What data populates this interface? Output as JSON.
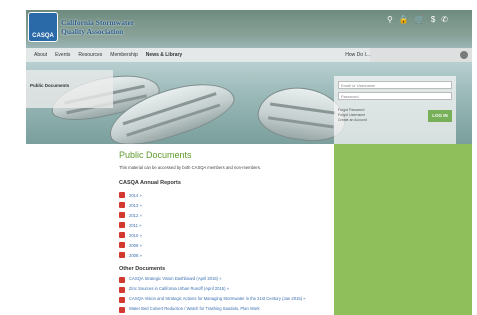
{
  "logo": {
    "mark_text": "CASQA",
    "line1": "California Stormwater",
    "line2": "Quality Association"
  },
  "top_icons": [
    "person-icon",
    "lock-icon",
    "cart-icon",
    "dollar-icon",
    "phone-icon"
  ],
  "top_icon_glyphs": [
    "⚲",
    "🔒",
    "🛒",
    "$",
    "✆"
  ],
  "nav": {
    "items": [
      "About",
      "Events",
      "Resources",
      "Membership",
      "News & Library"
    ],
    "active_index": 4,
    "howdo": "How Do I..."
  },
  "sidebar": {
    "label": "Public Documents"
  },
  "login": {
    "username_placeholder": "Email or Username",
    "password_placeholder": "Password",
    "links": [
      "Forgot Password",
      "Forgot Username",
      "Create an Account"
    ],
    "button": "LOG IN"
  },
  "main": {
    "title": "Public Documents",
    "intro": "This material can be accessed by both CASQA members and non-members.",
    "annual_heading": "CASQA Annual Reports",
    "annual_reports": [
      "2014 »",
      "2013 »",
      "2012 »",
      "2011 »",
      "2010 »",
      "2009 »",
      "2008 »"
    ],
    "other_heading": "Other Documents",
    "other_documents": [
      "CASQA Strategic Vision Dashboard (April 2016) »",
      "Zinc Sources in California Urban Runoff (April 2015) »",
      "CASQA Vision and Strategic Actions for Managing Stormwater in the 21st Century (Jan 2015) »",
      "Water Bed Culvert Reduction / Watch for Trashing Sandalo, Plan Work"
    ]
  },
  "colors": {
    "accent_green": "#8fbf5b",
    "title_green": "#5f9a2c",
    "link_blue": "#3a6fb0",
    "pdf_red": "#d33a2f"
  }
}
